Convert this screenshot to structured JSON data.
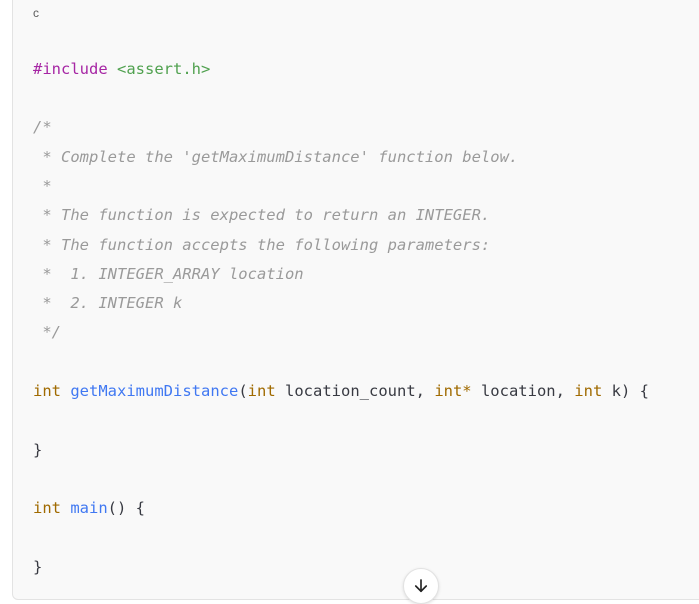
{
  "code_block": {
    "language": "c",
    "lines": {
      "include_directive": "#include",
      "include_header": "<assert.h>",
      "comment_open": "/*",
      "comment_line1": " * Complete the 'getMaximumDistance' function below.",
      "comment_line2": " *",
      "comment_line3": " * The function is expected to return an INTEGER.",
      "comment_line4": " * The function accepts the following parameters:",
      "comment_line5": " *  1. INTEGER_ARRAY location",
      "comment_line6": " *  2. INTEGER k",
      "comment_close": " */",
      "fn_return_type": "int",
      "fn_name": "getMaximumDistance",
      "fn_paren_open": "(",
      "param1_type": "int",
      "param1_name": " location_count, ",
      "param2_type": "int*",
      "param2_name": " location, ",
      "param3_type": "int",
      "param3_rest": " k) {",
      "fn_close": "}",
      "main_return_type": "int",
      "main_name": "main",
      "main_rest": "() {",
      "main_close": "}"
    }
  },
  "scroll_button": {
    "icon": "arrow-down-icon"
  }
}
